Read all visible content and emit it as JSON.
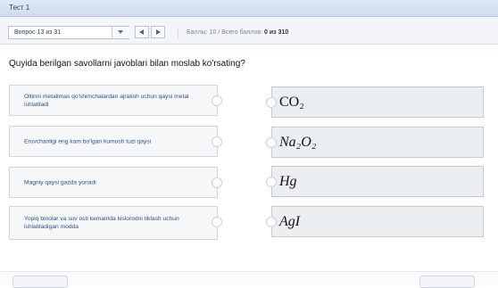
{
  "window": {
    "title": "Тест 1"
  },
  "toolbar": {
    "question_select": "Вопрос 13 из 31",
    "score_label": "Баллы: 10",
    "separator": "/",
    "total_label": "Всего баллов: ",
    "total_value": "0 из 310"
  },
  "question": "Quyida berilgan savollarni javoblari bilan moslab ko'rsating?",
  "pairs": [
    {
      "left": "Oltinni metallmas qo'shimchalardan ajratish uchun qaysi metal ishlatiladi",
      "right": "CO₂",
      "right_italic": false
    },
    {
      "left": "Eruvchanligi eng kam bo'lgan kumush tuzi qaysi",
      "right": "Na₂O₂",
      "right_italic": true
    },
    {
      "left": "Magniy qaysi gazda yonadi",
      "right": "Hg",
      "right_italic": true
    },
    {
      "left": "Yopiq binolar va suv osti kemalrida kislorodni tiklash uchun ishlatiladigan modda",
      "right": "AgI",
      "right_italic": true
    }
  ],
  "colors": {
    "titlebar": "#d6e2f3",
    "left_text": "#2d4f8b",
    "nav_arrow": "#3d67b0"
  },
  "icons": {
    "dropdown": "chevron-down-icon",
    "prev": "arrow-left-icon",
    "next": "arrow-right-icon"
  }
}
